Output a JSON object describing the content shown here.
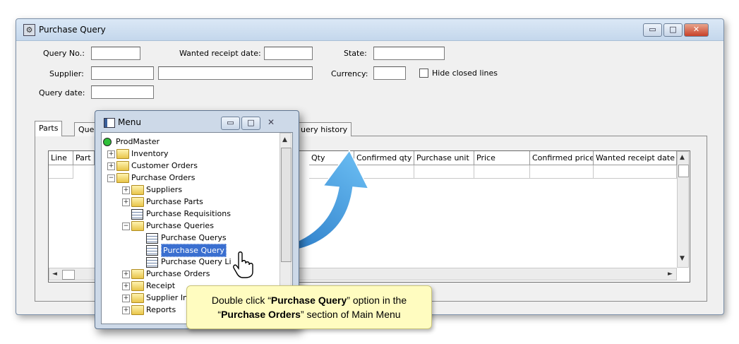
{
  "main_window": {
    "title": "Purchase Query",
    "controls": {
      "minimize": "▭",
      "maximize": "□",
      "close": "✕"
    }
  },
  "form": {
    "query_no_label": "Query No.:",
    "query_no_value": "",
    "wanted_receipt_date_label": "Wanted receipt date:",
    "wanted_receipt_date_value": "",
    "state_label": "State:",
    "state_value": "",
    "supplier_label": "Supplier:",
    "supplier_code": "",
    "supplier_name": "",
    "currency_label": "Currency:",
    "currency_value": "",
    "hide_closed_label": "Hide closed lines",
    "hide_closed_checked": false,
    "query_date_label": "Query date:",
    "query_date_value": ""
  },
  "tabs": [
    "Parts",
    "Quer",
    "uery history"
  ],
  "grid": {
    "columns": [
      "Line",
      "Part",
      "Qty",
      "Confirmed qty",
      "Purchase unit",
      "Price",
      "Confirmed price",
      "Wanted receipt date"
    ]
  },
  "menu_window": {
    "title": "Menu",
    "tree": [
      {
        "label": "ProdMaster",
        "icon": "root-icon",
        "level": 0
      },
      {
        "label": "Inventory",
        "icon": "folder-icon",
        "level": 1,
        "expander": "+"
      },
      {
        "label": "Customer Orders",
        "icon": "folder-icon",
        "level": 1,
        "expander": "+"
      },
      {
        "label": "Purchase Orders",
        "icon": "folder-open-icon",
        "level": 1,
        "expander": "−"
      },
      {
        "label": "Suppliers",
        "icon": "folder-icon",
        "level": 2,
        "expander": "+"
      },
      {
        "label": "Purchase Parts",
        "icon": "folder-icon",
        "level": 2,
        "expander": "+"
      },
      {
        "label": "Purchase Requisitions",
        "icon": "grid-icon",
        "level": 2
      },
      {
        "label": "Purchase Queries",
        "icon": "folder-open-icon",
        "level": 2,
        "expander": "−"
      },
      {
        "label": "Purchase Querys",
        "icon": "grid-icon",
        "level": 3
      },
      {
        "label": "Purchase Query",
        "icon": "form-icon",
        "level": 3,
        "selected": true
      },
      {
        "label": "Purchase Query Li",
        "icon": "grid-icon",
        "level": 3
      },
      {
        "label": "Purchase Orders",
        "icon": "folder-icon",
        "level": 2,
        "expander": "+"
      },
      {
        "label": "Receipt",
        "icon": "folder-icon",
        "level": 2,
        "expander": "+"
      },
      {
        "label": "Supplier In",
        "icon": "folder-icon",
        "level": 2,
        "expander": "+"
      },
      {
        "label": "Reports",
        "icon": "folder-icon",
        "level": 2,
        "expander": "+"
      }
    ]
  },
  "callout": {
    "line1_pre": "Double click “",
    "line1_bold": "Purchase Query",
    "line1_post": "” option in the",
    "line2_pre": "“",
    "line2_bold": "Purchase Orders",
    "line2_post": "” section of Main Menu"
  },
  "colors": {
    "accent_arrow": "#2f86d6",
    "selection": "#3a6fd0",
    "callout_bg": "#fffcc0"
  }
}
